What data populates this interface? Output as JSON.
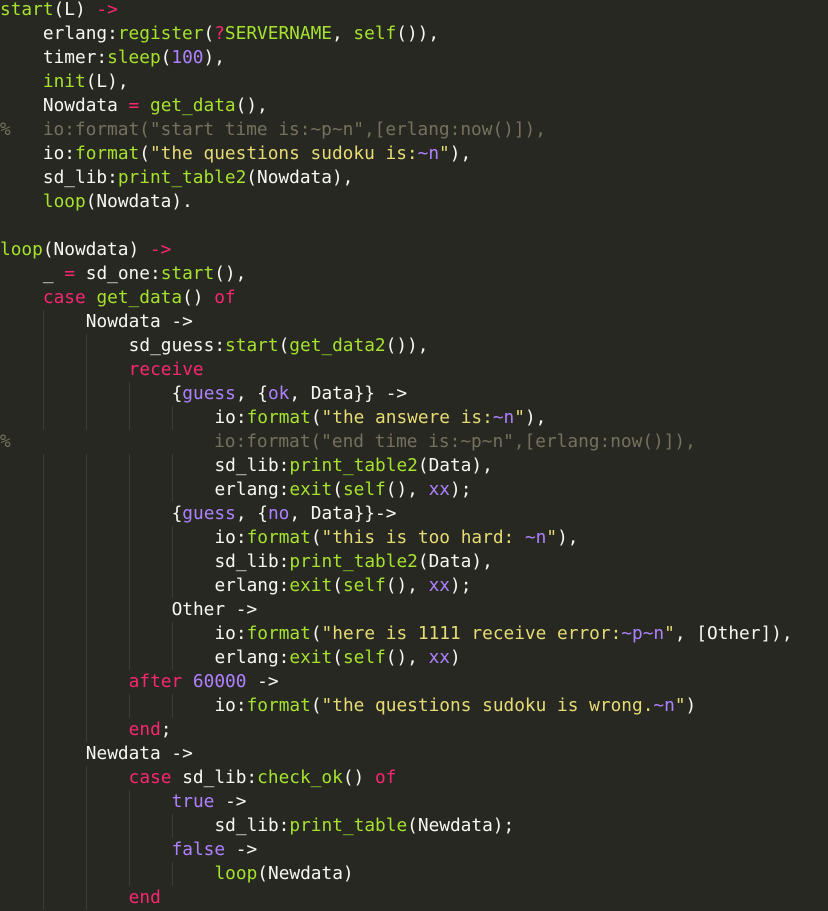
{
  "editor": {
    "language": "erlang",
    "theme_colors": {
      "background": "#272822",
      "text": "#f8f8f2",
      "function": "#a6e22e",
      "keyword": "#f92672",
      "atom_number": "#ae81ff",
      "string": "#e6db74",
      "comment": "#75715e"
    },
    "lines": [
      {
        "indent": 0,
        "tokens": [
          [
            "f",
            "start"
          ],
          [
            "t",
            "(L) "
          ],
          [
            "o",
            "->"
          ]
        ]
      },
      {
        "indent": 1,
        "tokens": [
          [
            "t",
            "erlang:"
          ],
          [
            "f",
            "register"
          ],
          [
            "t",
            "("
          ],
          [
            "o",
            "?"
          ],
          [
            "f",
            "SERVERNAME"
          ],
          [
            "t",
            ", "
          ],
          [
            "f",
            "self"
          ],
          [
            "t",
            "()),"
          ]
        ]
      },
      {
        "indent": 1,
        "tokens": [
          [
            "t",
            "timer:"
          ],
          [
            "f",
            "sleep"
          ],
          [
            "t",
            "("
          ],
          [
            "a",
            "100"
          ],
          [
            "t",
            "),"
          ]
        ]
      },
      {
        "indent": 1,
        "tokens": [
          [
            "f",
            "init"
          ],
          [
            "t",
            "(L),"
          ]
        ]
      },
      {
        "indent": 1,
        "tokens": [
          [
            "t",
            "Nowdata "
          ],
          [
            "o",
            "="
          ],
          [
            "t",
            " "
          ],
          [
            "f",
            "get_data"
          ],
          [
            "t",
            "(),"
          ]
        ]
      },
      {
        "indent": 0,
        "tokens": [
          [
            "c",
            "%   io:format(\"start time is:~p~n\",[erlang:now()]),"
          ]
        ]
      },
      {
        "indent": 1,
        "tokens": [
          [
            "t",
            "io:"
          ],
          [
            "f",
            "format"
          ],
          [
            "t",
            "("
          ],
          [
            "s",
            "\"the questions sudoku is:"
          ],
          [
            "e",
            "~n"
          ],
          [
            "s",
            "\""
          ],
          [
            "t",
            "),"
          ]
        ]
      },
      {
        "indent": 1,
        "tokens": [
          [
            "t",
            "sd_lib:"
          ],
          [
            "f",
            "print_table2"
          ],
          [
            "t",
            "(Nowdata),"
          ]
        ]
      },
      {
        "indent": 1,
        "tokens": [
          [
            "f",
            "loop"
          ],
          [
            "t",
            "(Nowdata)."
          ]
        ]
      },
      {
        "indent": 0,
        "tokens": []
      },
      {
        "indent": 0,
        "tokens": [
          [
            "f",
            "loop"
          ],
          [
            "t",
            "(Nowdata) "
          ],
          [
            "o",
            "->"
          ]
        ]
      },
      {
        "indent": 1,
        "tokens": [
          [
            "t",
            "_ "
          ],
          [
            "o",
            "="
          ],
          [
            "t",
            " sd_one:"
          ],
          [
            "f",
            "start"
          ],
          [
            "t",
            "(),"
          ]
        ]
      },
      {
        "indent": 1,
        "tokens": [
          [
            "k",
            "case"
          ],
          [
            "t",
            " "
          ],
          [
            "f",
            "get_data"
          ],
          [
            "t",
            "() "
          ],
          [
            "k",
            "of"
          ]
        ]
      },
      {
        "indent": 2,
        "tokens": [
          [
            "t",
            "Nowdata ->"
          ]
        ]
      },
      {
        "indent": 3,
        "tokens": [
          [
            "t",
            "sd_guess:"
          ],
          [
            "f",
            "start"
          ],
          [
            "t",
            "("
          ],
          [
            "f",
            "get_data2"
          ],
          [
            "t",
            "()),"
          ]
        ]
      },
      {
        "indent": 3,
        "tokens": [
          [
            "k",
            "receive"
          ]
        ]
      },
      {
        "indent": 4,
        "tokens": [
          [
            "t",
            "{"
          ],
          [
            "a",
            "guess"
          ],
          [
            "t",
            ", {"
          ],
          [
            "a",
            "ok"
          ],
          [
            "t",
            ", Data}} ->"
          ]
        ]
      },
      {
        "indent": 5,
        "tokens": [
          [
            "t",
            "io:"
          ],
          [
            "f",
            "format"
          ],
          [
            "t",
            "("
          ],
          [
            "s",
            "\"the answere is:"
          ],
          [
            "e",
            "~n"
          ],
          [
            "s",
            "\""
          ],
          [
            "t",
            "),"
          ]
        ]
      },
      {
        "indent": 0,
        "tokens": [
          [
            "c",
            "%                   io:format(\"end time is:~p~n\",[erlang:now()]),"
          ]
        ]
      },
      {
        "indent": 5,
        "tokens": [
          [
            "t",
            "sd_lib:"
          ],
          [
            "f",
            "print_table2"
          ],
          [
            "t",
            "(Data),"
          ]
        ]
      },
      {
        "indent": 5,
        "tokens": [
          [
            "t",
            "erlang:"
          ],
          [
            "f",
            "exit"
          ],
          [
            "t",
            "("
          ],
          [
            "f",
            "self"
          ],
          [
            "t",
            "(), "
          ],
          [
            "a",
            "xx"
          ],
          [
            "t",
            ");"
          ]
        ]
      },
      {
        "indent": 4,
        "tokens": [
          [
            "t",
            "{"
          ],
          [
            "a",
            "guess"
          ],
          [
            "t",
            ", {"
          ],
          [
            "a",
            "no"
          ],
          [
            "t",
            ", Data}}->"
          ]
        ]
      },
      {
        "indent": 5,
        "tokens": [
          [
            "t",
            "io:"
          ],
          [
            "f",
            "format"
          ],
          [
            "t",
            "("
          ],
          [
            "s",
            "\"this is too hard: "
          ],
          [
            "e",
            "~n"
          ],
          [
            "s",
            "\""
          ],
          [
            "t",
            "),"
          ]
        ]
      },
      {
        "indent": 5,
        "tokens": [
          [
            "t",
            "sd_lib:"
          ],
          [
            "f",
            "print_table2"
          ],
          [
            "t",
            "(Data),"
          ]
        ]
      },
      {
        "indent": 5,
        "tokens": [
          [
            "t",
            "erlang:"
          ],
          [
            "f",
            "exit"
          ],
          [
            "t",
            "("
          ],
          [
            "f",
            "self"
          ],
          [
            "t",
            "(), "
          ],
          [
            "a",
            "xx"
          ],
          [
            "t",
            ");"
          ]
        ]
      },
      {
        "indent": 4,
        "tokens": [
          [
            "t",
            "Other ->"
          ]
        ]
      },
      {
        "indent": 5,
        "tokens": [
          [
            "t",
            "io:"
          ],
          [
            "f",
            "format"
          ],
          [
            "t",
            "("
          ],
          [
            "s",
            "\"here is 1111 receive error:"
          ],
          [
            "e",
            "~p~n"
          ],
          [
            "s",
            "\""
          ],
          [
            "t",
            ", [Other]),"
          ]
        ]
      },
      {
        "indent": 5,
        "tokens": [
          [
            "t",
            "erlang:"
          ],
          [
            "f",
            "exit"
          ],
          [
            "t",
            "("
          ],
          [
            "f",
            "self"
          ],
          [
            "t",
            "(), "
          ],
          [
            "a",
            "xx"
          ],
          [
            "t",
            ")"
          ]
        ]
      },
      {
        "indent": 3,
        "tokens": [
          [
            "k",
            "after"
          ],
          [
            "t",
            " "
          ],
          [
            "a",
            "60000"
          ],
          [
            "t",
            " ->"
          ]
        ]
      },
      {
        "indent": 5,
        "tokens": [
          [
            "t",
            "io:"
          ],
          [
            "f",
            "format"
          ],
          [
            "t",
            "("
          ],
          [
            "s",
            "\"the questions sudoku is wrong."
          ],
          [
            "e",
            "~n"
          ],
          [
            "s",
            "\""
          ],
          [
            "t",
            ")"
          ]
        ]
      },
      {
        "indent": 3,
        "tokens": [
          [
            "k",
            "end"
          ],
          [
            "t",
            ";"
          ]
        ]
      },
      {
        "indent": 2,
        "tokens": [
          [
            "t",
            "Newdata ->"
          ]
        ]
      },
      {
        "indent": 3,
        "tokens": [
          [
            "k",
            "case"
          ],
          [
            "t",
            " sd_lib:"
          ],
          [
            "f",
            "check_ok"
          ],
          [
            "t",
            "() "
          ],
          [
            "k",
            "of"
          ]
        ]
      },
      {
        "indent": 4,
        "tokens": [
          [
            "a",
            "true"
          ],
          [
            "t",
            " ->"
          ]
        ]
      },
      {
        "indent": 5,
        "tokens": [
          [
            "t",
            "sd_lib:"
          ],
          [
            "f",
            "print_table"
          ],
          [
            "t",
            "(Newdata);"
          ]
        ]
      },
      {
        "indent": 4,
        "tokens": [
          [
            "a",
            "false"
          ],
          [
            "t",
            " ->"
          ]
        ]
      },
      {
        "indent": 5,
        "tokens": [
          [
            "f",
            "loop"
          ],
          [
            "t",
            "(Newdata)"
          ]
        ]
      },
      {
        "indent": 3,
        "tokens": [
          [
            "k",
            "end"
          ]
        ]
      }
    ]
  }
}
